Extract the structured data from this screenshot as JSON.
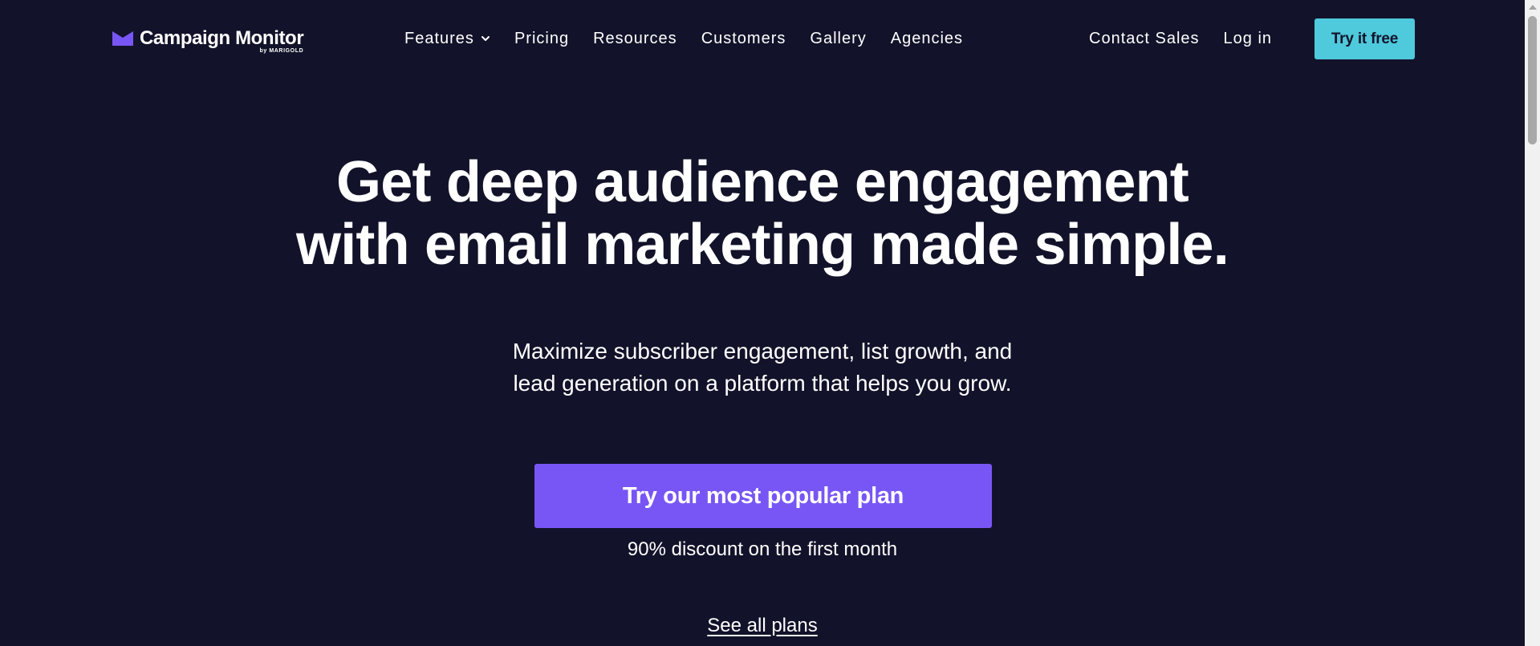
{
  "header": {
    "logo": {
      "name": "Campaign Monitor",
      "sub": "by MARIGOLD"
    },
    "nav": [
      {
        "label": "Features",
        "has_dropdown": true
      },
      {
        "label": "Pricing"
      },
      {
        "label": "Resources"
      },
      {
        "label": "Customers"
      },
      {
        "label": "Gallery"
      },
      {
        "label": "Agencies"
      }
    ],
    "contact_sales": "Contact Sales",
    "login": "Log in",
    "try_free": "Try it free"
  },
  "hero": {
    "title_line1": "Get deep audience engagement",
    "title_line2": "with email marketing made simple.",
    "sub_line1": "Maximize subscriber engagement, list growth, and",
    "sub_line2": "lead generation on a platform that helps you grow.",
    "cta": "Try our most popular plan",
    "discount": "90% discount on the first month",
    "see_plans": "See all plans"
  },
  "colors": {
    "background": "#12132a",
    "accent_purple": "#7856f5",
    "accent_cyan": "#4fc9dc",
    "text": "#ffffff"
  },
  "icons": {
    "logo_mark": "envelope-logo-icon",
    "dropdown": "chevron-down-icon"
  }
}
